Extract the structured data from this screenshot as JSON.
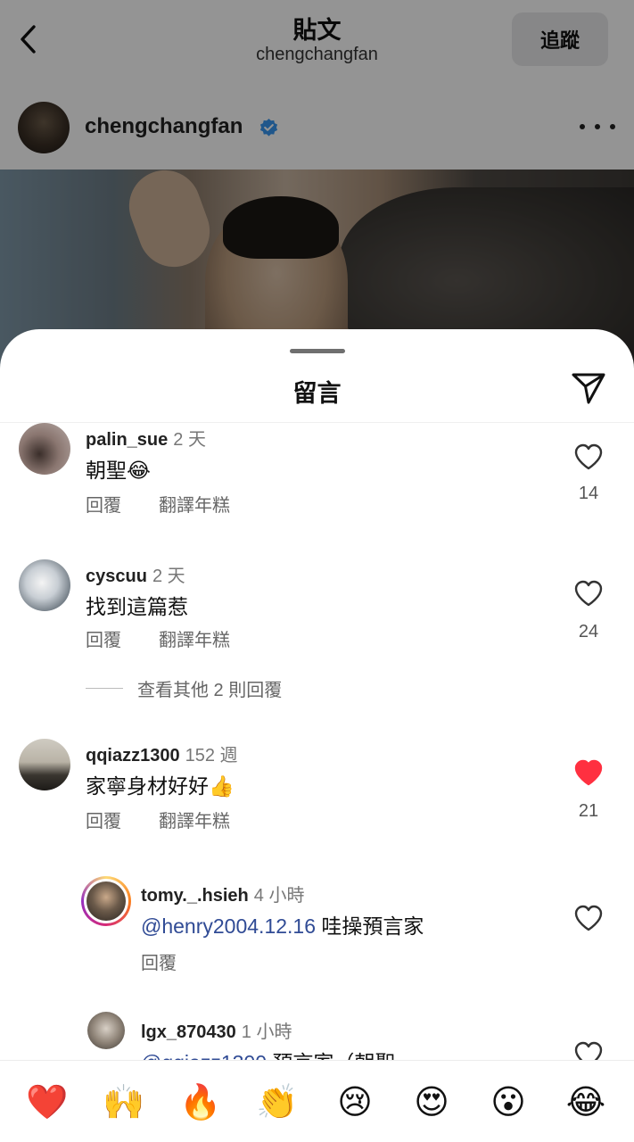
{
  "header": {
    "title": "貼文",
    "subtitle": "chengchangfan",
    "follow_label": "追蹤"
  },
  "author": {
    "name": "chengchangfan"
  },
  "sheet": {
    "title": "留言"
  },
  "comments": [
    {
      "user": "palin_sue",
      "time": "2 天",
      "text": "朝聖😂",
      "actions": [
        "回覆",
        "翻譯年糕"
      ],
      "likes": "14",
      "liked": false
    },
    {
      "user": "cyscuu",
      "time": "2 天",
      "text": "找到這篇惹",
      "actions": [
        "回覆",
        "翻譯年糕"
      ],
      "likes": "24",
      "liked": false,
      "view_replies": "查看其他 2 則回覆"
    },
    {
      "user": "qqiazz1300",
      "time": "152 週",
      "text": "家寧身材好好👍",
      "actions": [
        "回覆",
        "翻譯年糕"
      ],
      "likes": "21",
      "liked": true
    },
    {
      "user": "tomy._.hsieh",
      "time": "4 小時",
      "mention": "@henry2004.12.16",
      "text": "哇操預言家",
      "actions": [
        "回覆"
      ],
      "liked": false
    },
    {
      "user": "lgx_870430",
      "time": "1 小時",
      "mention": "@qqiazz1300",
      "text": "預言家（朝聖",
      "liked": false
    }
  ],
  "reactions": [
    "❤️",
    "🙌",
    "🔥",
    "👏",
    "😢",
    "😍",
    "😮",
    "😂"
  ],
  "colors": {
    "like_red": "#ff3040",
    "mention_blue": "#304b95",
    "verified_blue": "#3897f0"
  }
}
